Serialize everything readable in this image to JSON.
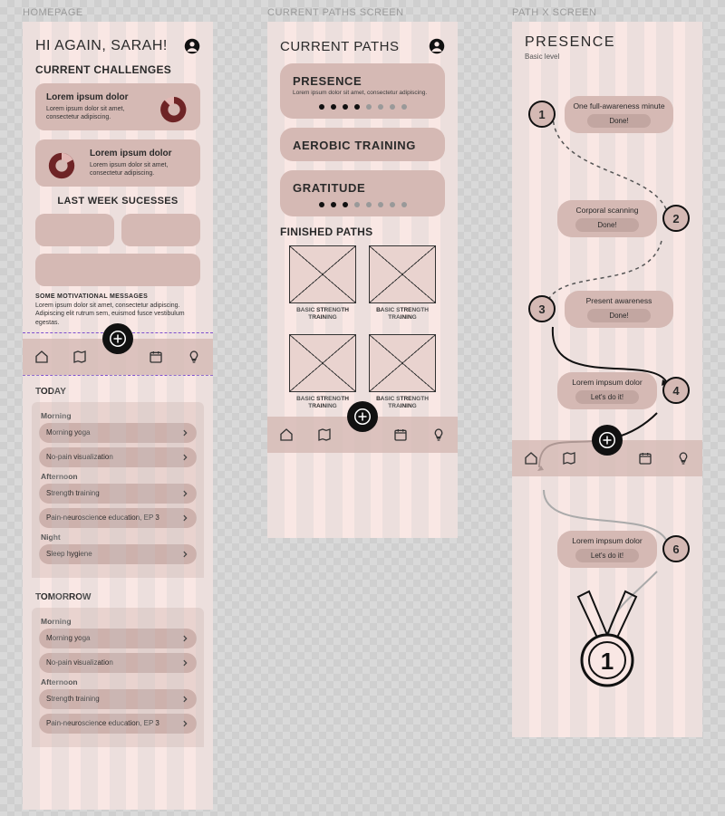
{
  "labels": {
    "frame1": "HOMEPAGE",
    "frame2": "CURRENT PATHS SCREEN",
    "frame3": "PATH X SCREEN"
  },
  "home": {
    "greeting": "HI AGAIN, SARAH!",
    "section_challenges": "CURRENT CHALLENGES",
    "challenge1": {
      "title": "Lorem ipsum dolor",
      "desc": "Lorem ipsum dolor sit amet, consectetur adipiscing."
    },
    "challenge2": {
      "title": "Lorem ipsum dolor",
      "desc": "Lorem ipsum dolor sit amet, consectetur adipiscing."
    },
    "section_last_week": "LAST WEEK SUCESSES",
    "motiv_label": "SOME MOTIVATIONAL MESSAGES",
    "motiv_text": "Lorem ipsum dolor sit amet, consectetur adipiscing. Adipiscing elit rutrum sem, euismod fusce vestibulum egestas.",
    "today_heading": "TODAY",
    "tomorrow_heading": "TOMORROW",
    "tod": {
      "morning": "Morning",
      "afternoon": "Afternoon",
      "night": "Night"
    },
    "activities": {
      "morning": [
        "Morning yoga",
        "No-pain visualization"
      ],
      "afternoon": [
        "Strength training",
        "Pain-neuroscience education, EP 3"
      ],
      "night": [
        "Sleep hygiene"
      ]
    }
  },
  "paths": {
    "heading": "CURRENT PATHS",
    "items": [
      {
        "title": "PRESENCE",
        "desc": "Lorem ipsum dolor sit amet, consectetur adipiscing.",
        "progress": 4,
        "total": 8
      },
      {
        "title": "AEROBIC TRAINING",
        "desc": "",
        "progress": 0,
        "total": 0
      },
      {
        "title": "GRATITUDE",
        "desc": "",
        "progress": 3,
        "total": 8
      }
    ],
    "finished_heading": "FINISHED PATHS",
    "finished": [
      "BASIC STRENGTH TRAINING",
      "BASIC STRENGTH TRAINING",
      "BASIC STRENGTH TRAINING",
      "BASIC STRENGTH TRAINING"
    ]
  },
  "pathx": {
    "title": "PRESENCE",
    "subtitle": "Basic level",
    "steps": [
      {
        "n": "1",
        "label": "One full-awareness minute",
        "status": "Done!"
      },
      {
        "n": "2",
        "label": "Corporal scanning",
        "status": "Done!"
      },
      {
        "n": "3",
        "label": "Present awareness",
        "status": "Done!"
      },
      {
        "n": "4",
        "label": "Lorem impsum dolor",
        "status": "Let's do it!"
      },
      {
        "n": "6",
        "label": "Lorem impsum dolor",
        "status": "Let's do it!"
      }
    ],
    "medal_rank": "1"
  }
}
